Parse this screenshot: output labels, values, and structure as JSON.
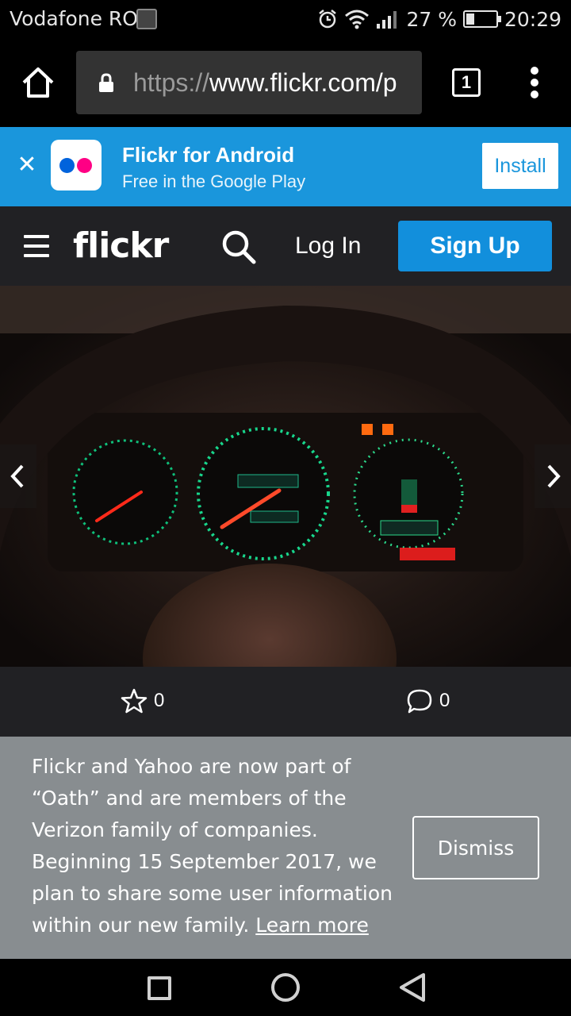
{
  "status_bar": {
    "carrier": "Vodafone RO",
    "battery_text": "27 %",
    "battery_level": 0.27,
    "time": "20:29"
  },
  "browser": {
    "url_scheme": "https://",
    "url_host": "www.flickr.com/p",
    "tab_count": "1"
  },
  "app_banner": {
    "title": "Flickr for Android",
    "subtitle": "Free in the Google Play",
    "install_label": "Install"
  },
  "nav": {
    "logo": "flickr",
    "login_label": "Log In",
    "signup_label": "Sign Up"
  },
  "photo_actions": {
    "favorites_count": "0",
    "comments_count": "0"
  },
  "notice": {
    "text": "Flickr and Yahoo are now part of “Oath” and are members of the Verizon family of companies. Beginning 15 September 2017, we plan to share some user information within our new family. ",
    "link_label": "Learn more",
    "dismiss_label": "Dismiss"
  },
  "colors": {
    "banner_blue": "#1a96dc",
    "signup_blue": "#128fdc",
    "nav_dark": "#212124",
    "notice_gray": "#888d90"
  },
  "icons": [
    "home-icon",
    "lock-icon",
    "tabs-icon",
    "overflow-menu-icon",
    "close-icon",
    "flickr-dots-icon",
    "hamburger-icon",
    "search-icon",
    "chevron-left-icon",
    "chevron-right-icon",
    "star-icon",
    "comment-icon",
    "recent-apps-icon",
    "home-circle-icon",
    "back-triangle-icon"
  ]
}
